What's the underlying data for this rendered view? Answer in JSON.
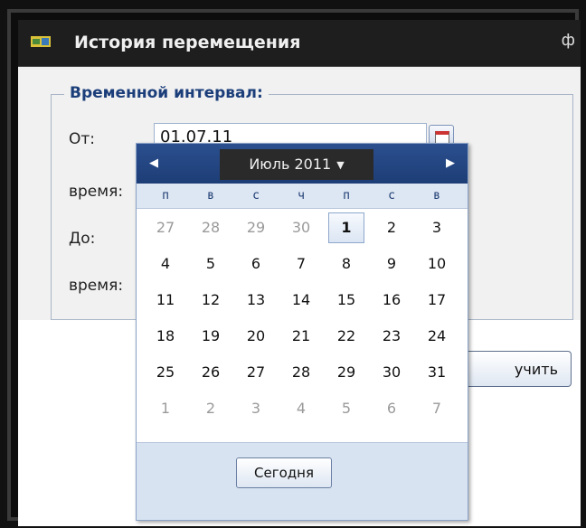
{
  "window": {
    "title": "История перемещения",
    "pin_glyph": "ф"
  },
  "form": {
    "legend": "Временной интервал:",
    "from_label": "От:",
    "time_label_1": "время:",
    "to_label": "До:",
    "time_label_2": "время:",
    "from_value": "01.07.11",
    "get_button": "учить"
  },
  "calendar": {
    "month_label": "Июль 2011",
    "weekdays": [
      "п",
      "в",
      "с",
      "ч",
      "п",
      "с",
      "в"
    ],
    "weeks": [
      [
        {
          "d": "27",
          "o": true
        },
        {
          "d": "28",
          "o": true
        },
        {
          "d": "29",
          "o": true
        },
        {
          "d": "30",
          "o": true
        },
        {
          "d": "1",
          "o": false,
          "sel": true
        },
        {
          "d": "2",
          "o": false
        },
        {
          "d": "3",
          "o": false
        }
      ],
      [
        {
          "d": "4"
        },
        {
          "d": "5"
        },
        {
          "d": "6"
        },
        {
          "d": "7"
        },
        {
          "d": "8"
        },
        {
          "d": "9"
        },
        {
          "d": "10"
        }
      ],
      [
        {
          "d": "11"
        },
        {
          "d": "12"
        },
        {
          "d": "13"
        },
        {
          "d": "14"
        },
        {
          "d": "15"
        },
        {
          "d": "16"
        },
        {
          "d": "17"
        }
      ],
      [
        {
          "d": "18"
        },
        {
          "d": "19"
        },
        {
          "d": "20"
        },
        {
          "d": "21"
        },
        {
          "d": "22"
        },
        {
          "d": "23"
        },
        {
          "d": "24"
        }
      ],
      [
        {
          "d": "25"
        },
        {
          "d": "26"
        },
        {
          "d": "27"
        },
        {
          "d": "28"
        },
        {
          "d": "29"
        },
        {
          "d": "30"
        },
        {
          "d": "31"
        }
      ],
      [
        {
          "d": "1",
          "o": true
        },
        {
          "d": "2",
          "o": true
        },
        {
          "d": "3",
          "o": true
        },
        {
          "d": "4",
          "o": true
        },
        {
          "d": "5",
          "o": true
        },
        {
          "d": "6",
          "o": true
        },
        {
          "d": "7",
          "o": true
        }
      ]
    ],
    "today_button": "Сегодня"
  },
  "colors": {
    "header": "#1d3d76",
    "legend_text": "#1b3e7a"
  },
  "icons": {
    "title": "route-map-icon",
    "calendar": "calendar-icon",
    "prev": "triangle-left-icon",
    "next": "triangle-right-icon",
    "pin": "pin-icon"
  }
}
